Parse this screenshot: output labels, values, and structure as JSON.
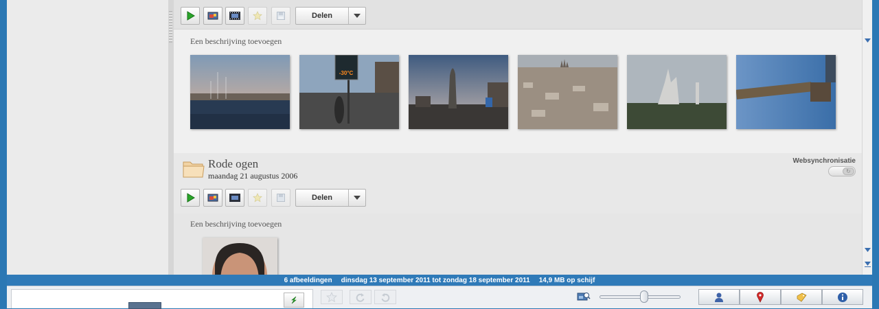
{
  "toolbar": {
    "play": "play-icon",
    "to_album": "add-picture-icon",
    "movie": "filmstrip-icon",
    "star": "star-icon",
    "save": "save-icon",
    "share_label": "Delen",
    "share_menu": "chevron-down-icon"
  },
  "sections": [
    {
      "description_placeholder": "Een beschrijving toevoegen",
      "thumbnails": [
        {
          "subject": "harbor-sailboats"
        },
        {
          "subject": "street-thermometer",
          "thermometer_text": "-30°C"
        },
        {
          "subject": "square-statue"
        },
        {
          "subject": "city-aerial"
        },
        {
          "subject": "hill-church"
        },
        {
          "subject": "column-monument"
        }
      ]
    },
    {
      "title": "Rode ogen",
      "date": "maandag 21 augustus 2006",
      "websync_label": "Websynchronisatie",
      "description_placeholder": "Een beschrijving toevoegen",
      "thumbnails": [
        {
          "subject": "baby-portrait"
        }
      ]
    }
  ],
  "status": {
    "count": "6 afbeeldingen",
    "range": "dinsdag 13 september 2011 tot zondag 18 september 2011",
    "size": "14,9 MB op schijf"
  },
  "bottom": {
    "icons": [
      "green-arrow-icon",
      "star-icon",
      "rotate-left-icon",
      "rotate-right-icon",
      "zoom-icon",
      "person-icon",
      "map-pin-icon",
      "tag-icon",
      "info-icon"
    ],
    "zoom_level": 0.5
  },
  "colors": {
    "accent": "#2b78b4",
    "status_bar": "#2f7ab8"
  }
}
